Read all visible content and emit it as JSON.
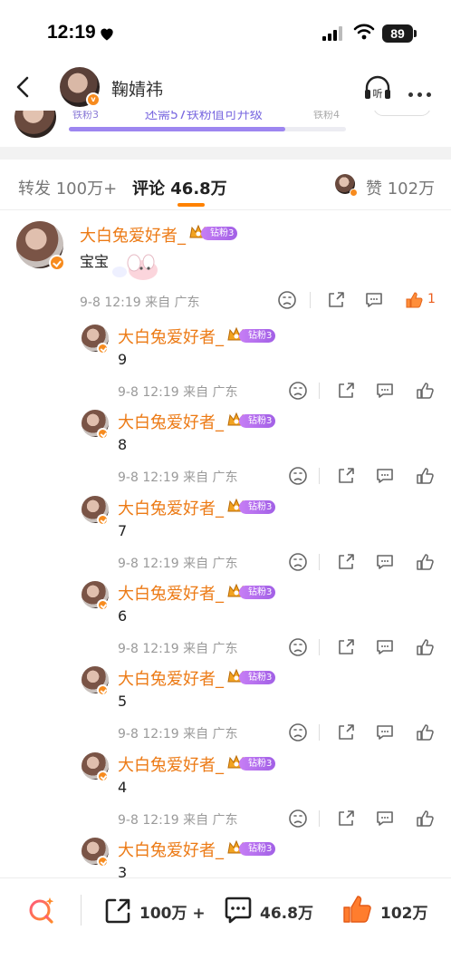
{
  "status_bar": {
    "time": "12:19",
    "battery": "89"
  },
  "header": {
    "title": "鞠婧祎"
  },
  "fan_strip": {
    "level_left": "铁粉3",
    "progress_text": "还需57铁粉值可升级",
    "level_right": "铁粉4",
    "progress": 0.78
  },
  "tabs": {
    "repost": "转发 100万+",
    "comment": "评论 46.8万",
    "like": "赞 102万"
  },
  "main_comment": {
    "username": "大白兔爱好者_",
    "badge": "钻粉3",
    "text": "宝宝",
    "meta": "9-8 12:19  来自 广东",
    "like_count": "1"
  },
  "replies": [
    {
      "username": "大白兔爱好者_",
      "badge": "钻粉3",
      "text": "9",
      "meta": "9-8 12:19  来自 广东"
    },
    {
      "username": "大白兔爱好者_",
      "badge": "钻粉3",
      "text": "8",
      "meta": "9-8 12:19  来自 广东"
    },
    {
      "username": "大白兔爱好者_",
      "badge": "钻粉3",
      "text": "7",
      "meta": "9-8 12:19  来自 广东"
    },
    {
      "username": "大白兔爱好者_",
      "badge": "钻粉3",
      "text": "6",
      "meta": "9-8 12:19  来自 广东"
    },
    {
      "username": "大白兔爱好者_",
      "badge": "钻粉3",
      "text": "5",
      "meta": "9-8 12:19  来自 广东"
    },
    {
      "username": "大白兔爱好者_",
      "badge": "钻粉3",
      "text": "4",
      "meta": "9-8 12:19  来自 广东"
    },
    {
      "username": "大白兔爱好者_",
      "badge": "钻粉3",
      "text": "3"
    }
  ],
  "bottom_bar": {
    "repost": "100万 +",
    "comment": "46.8万",
    "like": "102万"
  },
  "colors": {
    "accent": "#ff8200",
    "username": "#ec7a15",
    "badge": "#a260e6",
    "like_active": "#ec5d1d"
  }
}
